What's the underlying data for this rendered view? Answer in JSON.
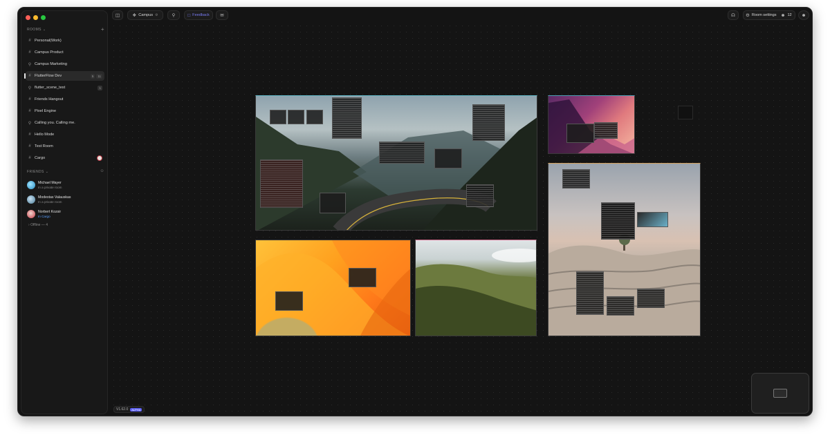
{
  "sidebar": {
    "rooms_heading": "ROOMS",
    "friends_heading": "FRIENDS",
    "rooms": [
      {
        "icon": "hash",
        "label": "Personal(Work)"
      },
      {
        "icon": "hash",
        "label": "Campus Product"
      },
      {
        "icon": "lock",
        "label": "Campus Marketing"
      },
      {
        "icon": "hash",
        "label": "FlutterFlow Dev",
        "active": true,
        "badges": [
          "5",
          "11"
        ]
      },
      {
        "icon": "lock",
        "label": "flutter_scene_test",
        "badges": [
          "1"
        ]
      },
      {
        "icon": "hash",
        "label": "Friends Hangout"
      },
      {
        "icon": "hash",
        "label": "Pixel Engine"
      },
      {
        "icon": "lock",
        "label": "Calling you. Calling me."
      },
      {
        "icon": "hash",
        "label": "Hello Mode"
      },
      {
        "icon": "hash",
        "label": "Test Room"
      },
      {
        "icon": "hash",
        "label": "Cargo"
      }
    ],
    "friends": [
      {
        "name": "Michael Mayer",
        "status": "In a private room"
      },
      {
        "name": "Modestas Valauskas",
        "status": "In a private room"
      },
      {
        "name": "Norbert Kozsir",
        "status": "In Cargo"
      }
    ],
    "offline": "Offline — 4"
  },
  "toolbar": {
    "room_name": "Campus",
    "feedback_label": "Feedback",
    "room_settings_label": "Room settings",
    "participants_count": "12"
  },
  "footer": {
    "version": "V1.62.0",
    "version_tag": "ALPHA"
  },
  "colors": {
    "accent": "#7b7df5",
    "active_room_bg": "#2a2a2a",
    "canvas_bg": "#141414"
  }
}
